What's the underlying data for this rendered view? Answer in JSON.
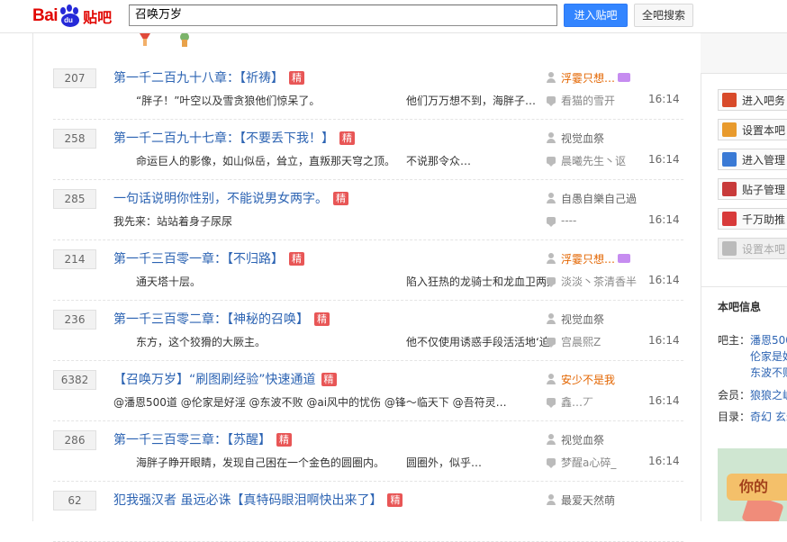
{
  "header": {
    "logo_bai": "Bai",
    "logo_du": "du",
    "logo_tieba": "贴吧",
    "search_value": "召唤万岁",
    "enter_button": "进入贴吧",
    "all_button": "全吧搜索"
  },
  "threads": [
    {
      "count": "207",
      "title": "第一千二百九十八章：【祈祷】",
      "jing": "精",
      "abs1": "“胖子！”叶空以及雪贪狼他们惊呆了。",
      "abs2": "他们万万想不到，海胖子…",
      "author": "浮霎只想…",
      "author_color": "#e36500",
      "vip": true,
      "reply": "看猫的雪开",
      "time": "16:14"
    },
    {
      "count": "258",
      "title": "第一千二百九十七章：【不要丢下我！】",
      "jing": "精",
      "abs1": "命运巨人的影像，如山似岳，耸立，直叛那天穹之顶。",
      "abs2": "不说那令众…",
      "author": "视觉血祭",
      "author_color": "#666666",
      "vip": false,
      "reply": "晨曦先生丶讴",
      "time": "16:14"
    },
    {
      "count": "285",
      "title": "一句话说明你性别，不能说男女两字。",
      "jing": "精",
      "abs1": "我先来：站站着身子尿尿",
      "abs2": "",
      "author": "自愚自樂自己過",
      "author_color": "#666666",
      "vip": false,
      "reply": "----",
      "time": "16:14"
    },
    {
      "count": "214",
      "title": "第一千三百零一章：【不归路】",
      "jing": "精",
      "abs1": "通天塔十层。",
      "abs2": "陷入狂热的龙骑士和龙血卫两大军团，以及一众支持…",
      "author": "浮霎只想…",
      "author_color": "#e36500",
      "vip": true,
      "reply": "淡淡丶茶清香半",
      "time": "16:14"
    },
    {
      "count": "236",
      "title": "第一千三百零二章：【神秘的召唤】",
      "jing": "精",
      "abs1": "东方，这个狡猾的大厥主。",
      "abs2": "他不仅使用诱惑手段活活地‘迫死’誓…",
      "author": "视觉血祭",
      "author_color": "#666666",
      "vip": false,
      "reply": "宫晨熙Z",
      "time": "16:14"
    },
    {
      "count": "6382",
      "title": "【召唤万岁】“刷图刷经验”快速通道",
      "jing": "精",
      "abs1": "@潘恩500道 @伦家是好淫 @东波不败 @ai风中的忧伤 @锋～临天下 @吾符灵…",
      "abs2": "",
      "author": "安少不是我",
      "author_color": "#e36500",
      "vip": false,
      "reply": "鑫…丆",
      "time": "16:14"
    },
    {
      "count": "286",
      "title": "第一千三百零三章：【苏醒】",
      "jing": "精",
      "abs1": "海胖子睁开眼睛，发现自己困在一个金色的圆圈内。",
      "abs2": "圆圈外，似乎…",
      "author": "视觉血祭",
      "author_color": "#666666",
      "vip": false,
      "reply": "梦醒a心碎_",
      "time": "16:14"
    },
    {
      "count": "62",
      "title": "犯我强汉者 虽远必诛【真特码眼泪啊快出来了】",
      "jing": "精",
      "abs1": "",
      "abs2": "",
      "author": "最爱天然萌",
      "author_color": "#666666",
      "vip": false,
      "reply": "",
      "time": ""
    }
  ],
  "sidebar": {
    "buttons": [
      {
        "label": "进入吧务",
        "icon": "enter-admin-icon",
        "color": "#d84a2a"
      },
      {
        "label": "设置本吧",
        "icon": "settings-icon",
        "color": "#e89a2c"
      },
      {
        "label": "进入管理",
        "icon": "manage-icon",
        "color": "#3a7ad5"
      },
      {
        "label": "贴子管理",
        "icon": "post-manage-icon",
        "color": "#c83a3a"
      },
      {
        "label": "千万助推",
        "icon": "boost-icon",
        "color": "#d83a3a"
      },
      {
        "label": "设置本吧",
        "icon": "settings-disabled-icon",
        "color": "#bbbbbb"
      }
    ],
    "info_title": "本吧信息",
    "owner_label": "吧主：",
    "owners": [
      "潘恩500",
      "伦家是好",
      "东波不败"
    ],
    "member_label": "会员：",
    "member_value": "狼狼之崛",
    "dir_label": "目录：",
    "dir_value": "奇幻 玄幻",
    "banner_text": "你的"
  }
}
